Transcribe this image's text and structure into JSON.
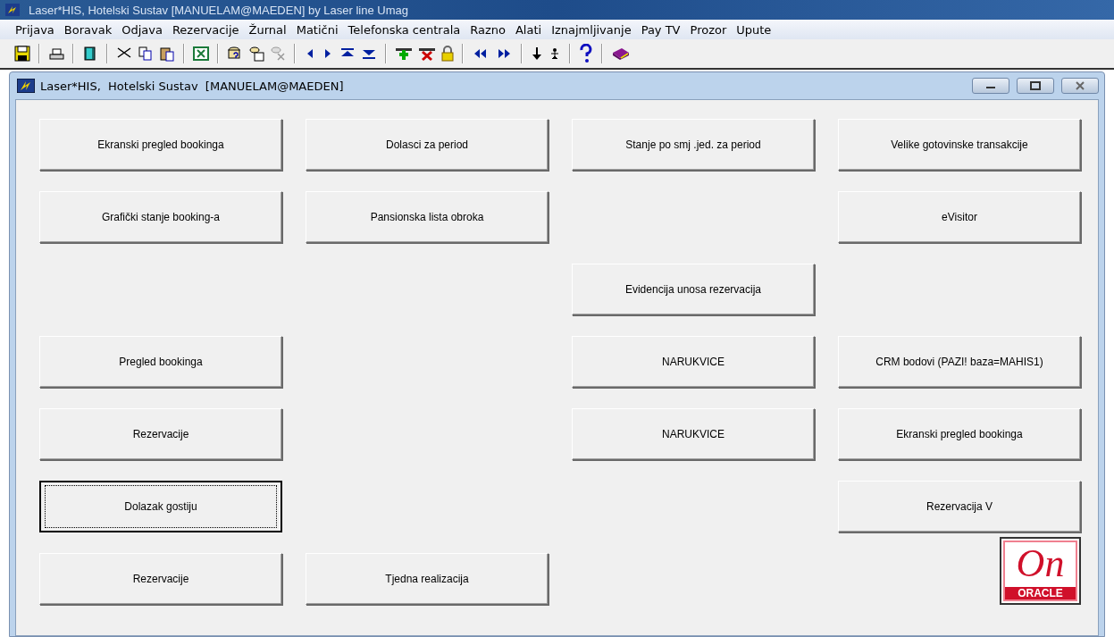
{
  "app_window": {
    "title": "Laser*HIS,  Hotelski Sustav  [MANUELAM@MAEDEN]  by Laser line Umag"
  },
  "menu": [
    "Prijava",
    "Boravak",
    "Odjava",
    "Rezervacije",
    "Žurnal",
    "Matični",
    "Telefonska centrala",
    "Razno",
    "Alati",
    "Iznajmljivanje",
    "Pay TV",
    "Prozor",
    "Upute"
  ],
  "window": {
    "title": "Laser*HIS,  Hotelski Sustav  [MANUELAM@MAEDEN]"
  },
  "button_grid": [
    [
      {
        "kind": "button",
        "label": "Ekranski pregled bookinga",
        "focused": false
      },
      {
        "kind": "button",
        "label": "Dolasci za period",
        "focused": false
      },
      {
        "kind": "button",
        "label": "Stanje po smj .jed. za period",
        "focused": false
      },
      {
        "kind": "button",
        "label": "Velike gotovinske transakcije",
        "focused": false
      }
    ],
    [
      {
        "kind": "button",
        "label": "Grafički stanje booking-a",
        "focused": false
      },
      {
        "kind": "button",
        "label": "Pansionska lista obroka",
        "focused": false
      },
      {
        "kind": "empty"
      },
      {
        "kind": "button",
        "label": "eVisitor",
        "focused": false
      }
    ],
    [
      {
        "kind": "empty"
      },
      {
        "kind": "empty"
      },
      {
        "kind": "button",
        "label": "Evidencija unosa rezervacija",
        "focused": false
      },
      {
        "kind": "empty"
      }
    ],
    [
      {
        "kind": "button",
        "label": "Pregled bookinga",
        "focused": false
      },
      {
        "kind": "empty"
      },
      {
        "kind": "button",
        "label": "NARUKVICE",
        "focused": false
      },
      {
        "kind": "button",
        "label": "CRM bodovi (PAZI! baza=MAHIS1)",
        "focused": false
      }
    ],
    [
      {
        "kind": "button",
        "label": "Rezervacije",
        "focused": false
      },
      {
        "kind": "empty"
      },
      {
        "kind": "button",
        "label": "NARUKVICE",
        "focused": false
      },
      {
        "kind": "button",
        "label": "Ekranski pregled bookinga",
        "focused": false
      }
    ],
    [
      {
        "kind": "button",
        "label": "Dolazak gostiju",
        "focused": true
      },
      {
        "kind": "empty"
      },
      {
        "kind": "empty"
      },
      {
        "kind": "button",
        "label": "Rezervacija V",
        "focused": false
      }
    ],
    [
      {
        "kind": "button",
        "label": "Rezervacije",
        "focused": false
      },
      {
        "kind": "button",
        "label": "Tjedna realizacija",
        "focused": false
      },
      {
        "kind": "empty"
      },
      {
        "kind": "logo",
        "word": "On",
        "brand": "ORACLE"
      }
    ]
  ]
}
